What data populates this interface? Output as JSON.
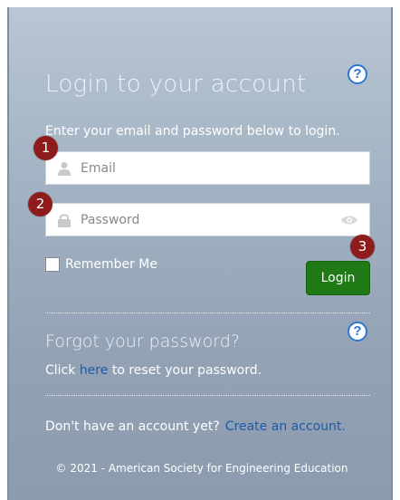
{
  "login": {
    "title": "Login to your account",
    "help_icon": "question-circle-icon",
    "instructions": "Enter your email and password below to login.",
    "email_placeholder": "Email",
    "email_value": "",
    "password_placeholder": "Password",
    "password_value": "",
    "remember_label": "Remember Me",
    "login_button": "Login"
  },
  "badges": [
    "1",
    "2",
    "3"
  ],
  "forgot": {
    "title": "Forgot your password?",
    "prefix": "Click",
    "link": "here",
    "suffix": "to reset your password."
  },
  "signup": {
    "prompt": "Don't have an account yet?",
    "link": "Create an account."
  },
  "footer": "© 2021 - American Society for Engineering Education",
  "colors": {
    "login_button": "#1f7a16",
    "badge": "#8e1c1c",
    "link": "#1e5aa8",
    "help_icon": "#2f76d1"
  }
}
